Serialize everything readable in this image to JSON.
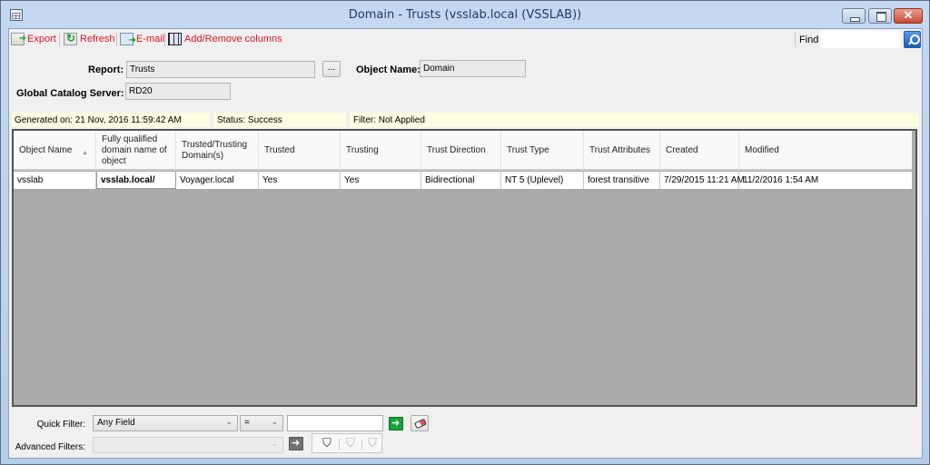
{
  "window": {
    "title": "Domain - Trusts (vsslab.local (VSSLAB))",
    "controls": {
      "minimize": "minimize",
      "maximize": "maximize",
      "close": "✕"
    }
  },
  "toolbar": {
    "items": [
      {
        "label": "Export",
        "icon": "export-icon"
      },
      {
        "label": "Refresh",
        "icon": "refresh-icon"
      },
      {
        "label": "E-mail",
        "icon": "email-icon"
      },
      {
        "label": "Add/Remove columns",
        "icon": "columns-icon"
      }
    ],
    "find_label": "Find",
    "find_value": ""
  },
  "form": {
    "report_label": "Report:",
    "report_value": "Trusts",
    "browse_label": "...",
    "object_name_label": "Object Name:",
    "object_name_value": "Domain",
    "gc_label": "Global  Catalog Server:",
    "gc_value": "RD20"
  },
  "info": {
    "generated": "Generated on: 21 Nov, 2016 11:59:42 AM",
    "status": "Status: Success",
    "filter": "Filter: Not Applied"
  },
  "table": {
    "columns": [
      "Object Name",
      "Fully qualified domain name of object",
      "Trusted/Trusting Domain(s)",
      "Trusted",
      "Trusting",
      "Trust Direction",
      "Trust Type",
      "Trust Attributes",
      "Created",
      "Modified"
    ],
    "sort_column": "Object Name",
    "sort_glyph": "▲",
    "rows": [
      [
        "vsslab",
        "vsslab.local/",
        "Voyager.local",
        "Yes",
        "Yes",
        "Bidirectional",
        "NT 5 (Uplevel)",
        "forest transitive",
        "7/29/2015 11:21 AM",
        "11/2/2016 1:54 AM"
      ]
    ]
  },
  "filters": {
    "quick_label": "Quick Filter:",
    "field_value": "Any Field",
    "operator_value": "=",
    "quick_value": "",
    "advanced_label": "Advanced Filters:",
    "advanced_value": "",
    "chevron": "⌄",
    "funnel_glyph": "⛉"
  }
}
